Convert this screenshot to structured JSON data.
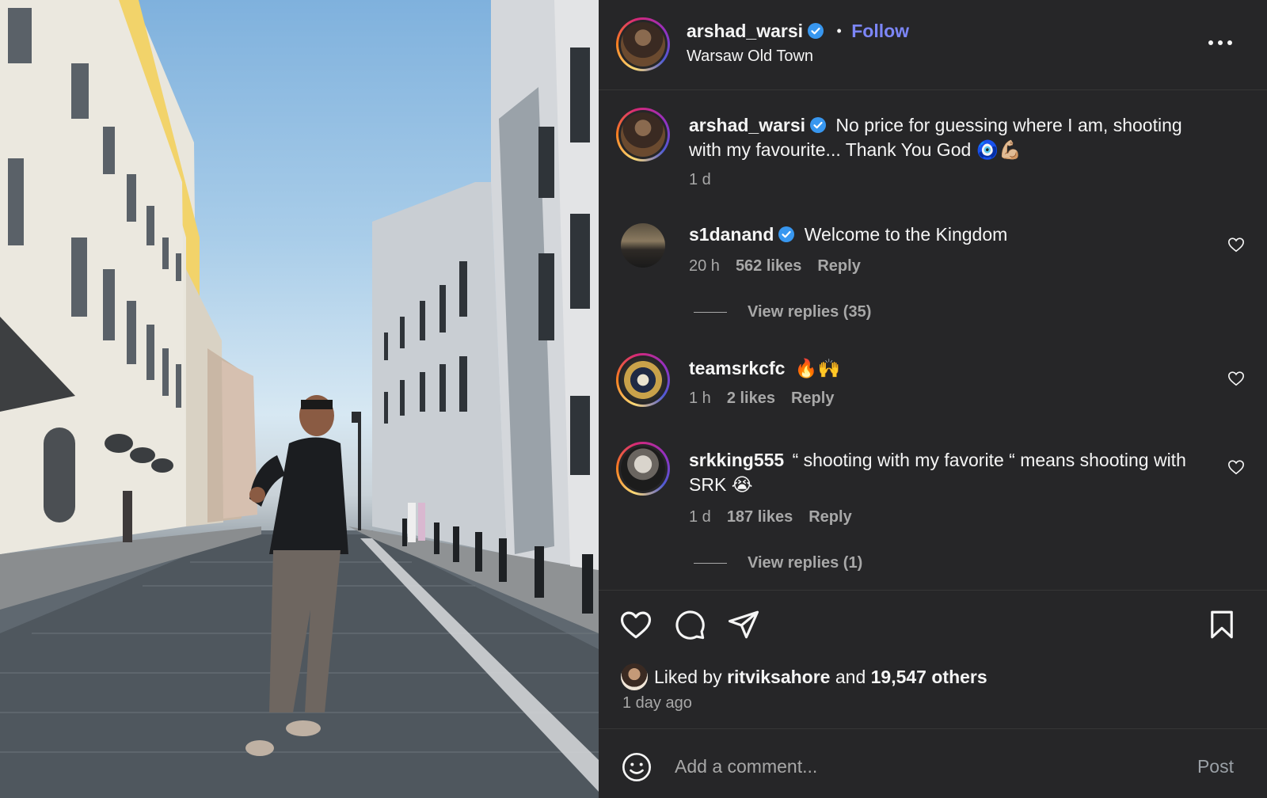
{
  "header": {
    "username": "arshad_warsi",
    "separator": "•",
    "follow_label": "Follow",
    "location": "Warsaw Old Town",
    "more_icon": "more-horizontal-icon"
  },
  "caption": {
    "username": "arshad_warsi",
    "text": "No price for guessing where I am, shooting with my favourite... Thank You God 🧿💪🏼",
    "time": "1 d"
  },
  "comments": [
    {
      "username": "s1danand",
      "verified": true,
      "text": "Welcome to the Kingdom",
      "time": "20 h",
      "likes": "562 likes",
      "reply_label": "Reply",
      "view_replies": "View replies (35)"
    },
    {
      "username": "teamsrkcfc",
      "verified": false,
      "text": "🔥🙌",
      "time": "1 h",
      "likes": "2 likes",
      "reply_label": "Reply"
    },
    {
      "username": "srkking555",
      "verified": false,
      "text": "“ shooting with my favorite “ means shooting with SRK 😭",
      "time": "1 d",
      "likes": "187 likes",
      "reply_label": "Reply",
      "view_replies": "View replies (1)"
    }
  ],
  "actions": {
    "like_icon": "heart-icon",
    "comment_icon": "comment-icon",
    "share_icon": "send-icon",
    "save_icon": "bookmark-icon"
  },
  "likes": {
    "prefix": "Liked by",
    "user": "ritviksahore",
    "middle": "and",
    "others": "19,547 others"
  },
  "post_time": "1 day ago",
  "comment_box": {
    "placeholder": "Add a comment...",
    "post_label": "Post",
    "emoji_icon": "smiley-icon"
  },
  "colors": {
    "panel_bg": "#262628",
    "follow": "#7c86f8",
    "verified": "#3897f0",
    "muted": "#a8a8a8"
  }
}
